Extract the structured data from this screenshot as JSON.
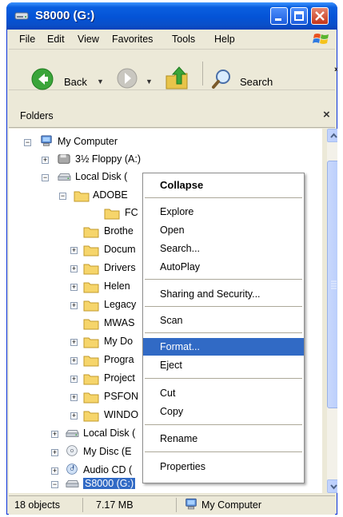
{
  "window": {
    "title": "S8000 (G:)"
  },
  "menubar": {
    "items": [
      "File",
      "Edit",
      "View",
      "Favorites",
      "Tools",
      "Help"
    ]
  },
  "toolbar": {
    "back_label": "Back",
    "search_label": "Search",
    "overflow": "»"
  },
  "folders_pane": {
    "title": "Folders",
    "close_glyph": "×"
  },
  "tree": {
    "items": [
      {
        "label": "My Computer",
        "expander": "−",
        "icon": "computer-icon"
      },
      {
        "label": "3½ Floppy (A:)",
        "expander": "+",
        "icon": "floppy-drive-icon"
      },
      {
        "label": "Local Disk (",
        "expander": "−",
        "icon": "hard-drive-icon"
      },
      {
        "label": "ADOBE",
        "expander": "−",
        "icon": "folder-icon"
      },
      {
        "label": "FC",
        "expander": "",
        "icon": "folder-icon"
      },
      {
        "label": "Brothe",
        "expander": "",
        "icon": "folder-icon"
      },
      {
        "label": "Docum",
        "expander": "+",
        "icon": "folder-icon"
      },
      {
        "label": "Drivers",
        "expander": "+",
        "icon": "folder-icon"
      },
      {
        "label": "Helen",
        "expander": "+",
        "icon": "folder-icon"
      },
      {
        "label": "Legacy",
        "expander": "+",
        "icon": "folder-icon"
      },
      {
        "label": "MWAS",
        "expander": "",
        "icon": "folder-icon"
      },
      {
        "label": "My Do",
        "expander": "+",
        "icon": "folder-icon"
      },
      {
        "label": "Progra",
        "expander": "+",
        "icon": "folder-icon"
      },
      {
        "label": "Project",
        "expander": "+",
        "icon": "folder-icon"
      },
      {
        "label": "PSFON",
        "expander": "+",
        "icon": "folder-icon"
      },
      {
        "label": "WINDO",
        "expander": "+",
        "icon": "folder-icon"
      },
      {
        "label": "Local Disk (",
        "expander": "+",
        "icon": "hard-drive-icon"
      },
      {
        "label": "My Disc (E",
        "expander": "+",
        "icon": "cd-drive-icon"
      },
      {
        "label": "Audio CD (",
        "expander": "+",
        "icon": "audio-cd-icon"
      },
      {
        "label": "S8000 (G:)",
        "expander": "−",
        "icon": "removable-drive-icon",
        "selected": true
      }
    ]
  },
  "context_menu": {
    "items": [
      {
        "label": "Collapse",
        "bold": true
      },
      {
        "label": "Explore"
      },
      {
        "label": "Open"
      },
      {
        "label": "Search..."
      },
      {
        "label": "AutoPlay"
      },
      {
        "label": "Sharing and Security..."
      },
      {
        "label": "Scan"
      },
      {
        "label": "Format...",
        "highlighted": true
      },
      {
        "label": "Eject"
      },
      {
        "label": "Cut"
      },
      {
        "label": "Copy"
      },
      {
        "label": "Rename"
      },
      {
        "label": "Properties"
      }
    ]
  },
  "statusbar": {
    "objects": "18 objects",
    "size": "7.17 MB",
    "location": "My Computer"
  },
  "colors": {
    "titlebar": "#0453d6",
    "highlight": "#316ac5",
    "chrome": "#ece9d8"
  }
}
